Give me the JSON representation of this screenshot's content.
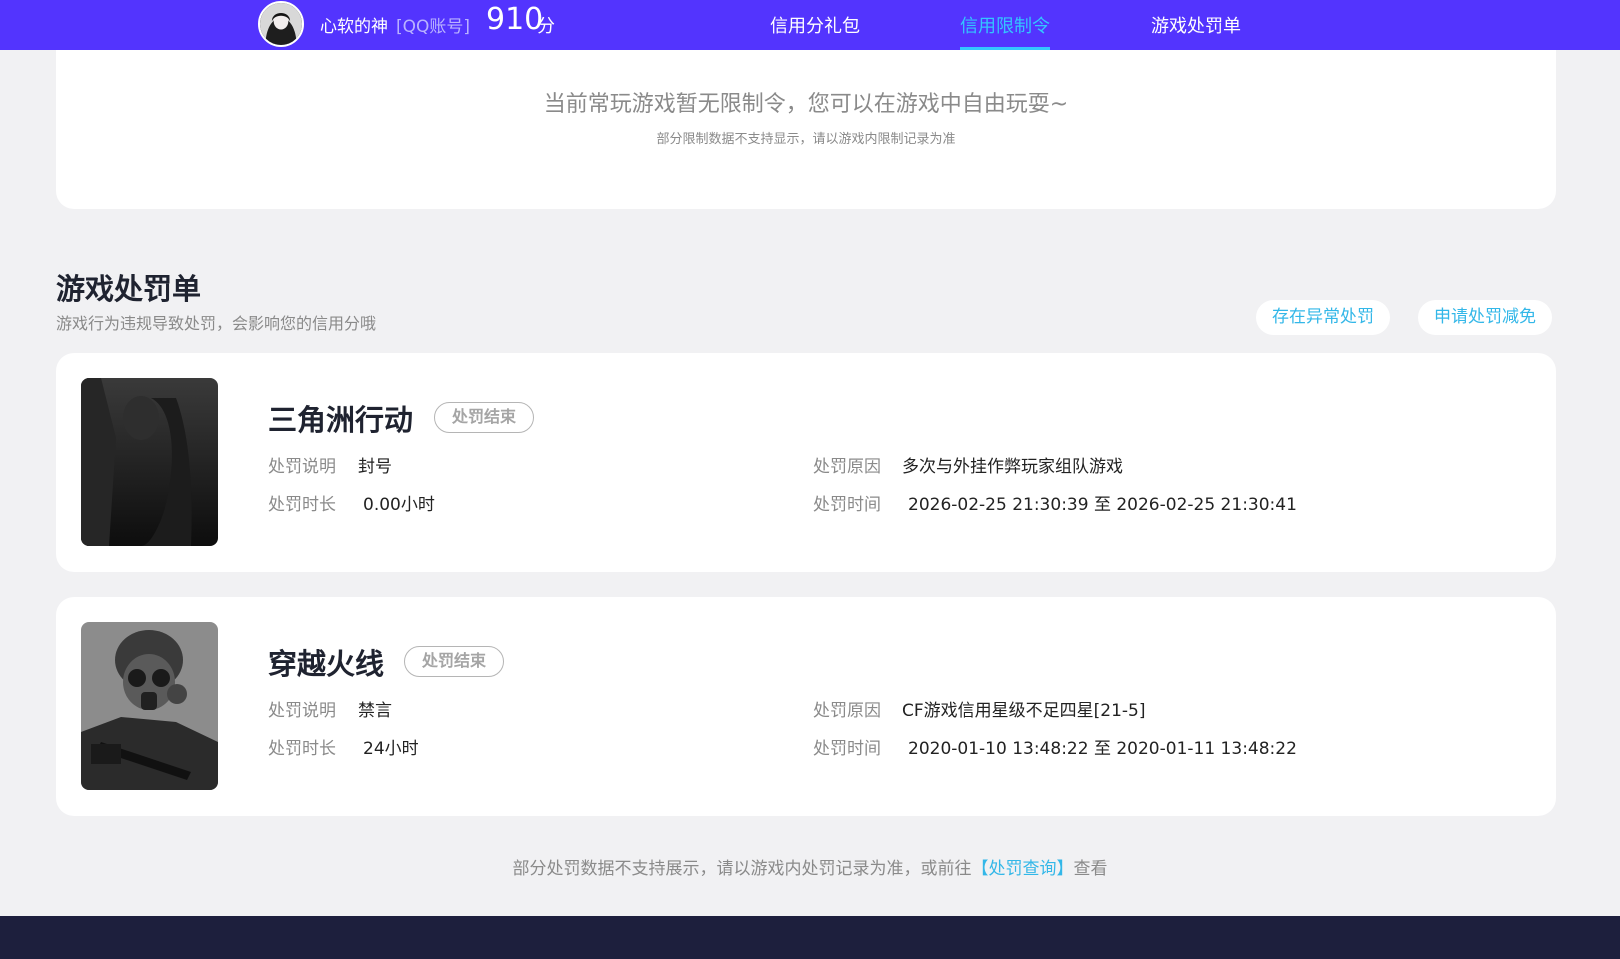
{
  "header": {
    "user_name": "心软的神",
    "account_type": "[QQ账号]",
    "score": "910",
    "score_unit": "分",
    "tabs": [
      {
        "label": "信用分礼包",
        "active": false
      },
      {
        "label": "信用限制令",
        "active": true
      },
      {
        "label": "游戏处罚单",
        "active": false
      }
    ]
  },
  "restriction": {
    "message": "当前常玩游戏暂无限制令，您可以在游戏中自由玩耍~",
    "note": "部分限制数据不支持显示，请以游戏内限制记录为准"
  },
  "penalties": {
    "title": "游戏处罚单",
    "description": "游戏行为违规导致处罚，会影响您的信用分哦",
    "actions": {
      "report_abnormal": "存在异常处罚",
      "apply_reduction": "申请处罚减免"
    },
    "labels": {
      "description": "处罚说明",
      "duration": "处罚时长",
      "reason": "处罚原因",
      "time": "处罚时间"
    },
    "items": [
      {
        "game": "三角洲行动",
        "status": "处罚结束",
        "description": "封号",
        "duration": "0.00小时",
        "reason": "多次与外挂作弊玩家组队游戏",
        "time": "2026-02-25 21:30:39 至 2026-02-25 21:30:41"
      },
      {
        "game": "穿越火线",
        "status": "处罚结束",
        "description": "禁言",
        "duration": "24小时",
        "reason": "CF游戏信用星级不足四星[21-5]",
        "time": "2020-01-10 13:48:22 至 2020-01-11 13:48:22"
      }
    ]
  },
  "footer": {
    "note_prefix": "部分处罚数据不支持展示，请以游戏内处罚记录为准，或前往",
    "link": "【处罚查询】",
    "note_suffix": "查看"
  },
  "colors": {
    "header_bg": "#5334fe",
    "accent": "#33c6ff",
    "link": "#33b7e8",
    "bottom_bar": "#1d1f3d"
  }
}
